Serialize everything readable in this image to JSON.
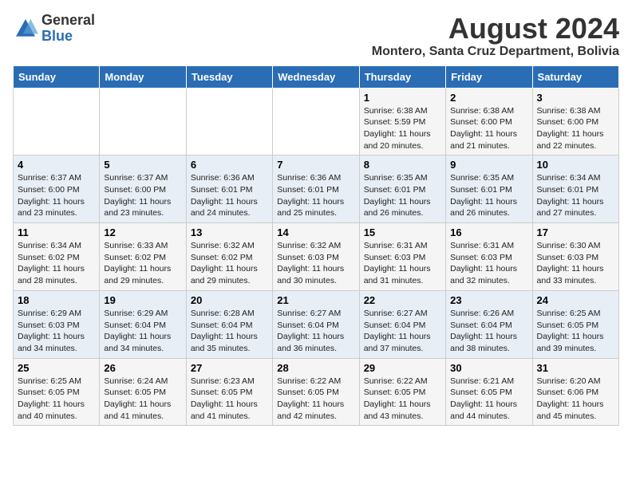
{
  "header": {
    "logo_general": "General",
    "logo_blue": "Blue",
    "month_year": "August 2024",
    "location": "Montero, Santa Cruz Department, Bolivia"
  },
  "weekdays": [
    "Sunday",
    "Monday",
    "Tuesday",
    "Wednesday",
    "Thursday",
    "Friday",
    "Saturday"
  ],
  "weeks": [
    [
      {
        "day": "",
        "info": ""
      },
      {
        "day": "",
        "info": ""
      },
      {
        "day": "",
        "info": ""
      },
      {
        "day": "",
        "info": ""
      },
      {
        "day": "1",
        "info": "Sunrise: 6:38 AM\nSunset: 5:59 PM\nDaylight: 11 hours\nand 20 minutes."
      },
      {
        "day": "2",
        "info": "Sunrise: 6:38 AM\nSunset: 6:00 PM\nDaylight: 11 hours\nand 21 minutes."
      },
      {
        "day": "3",
        "info": "Sunrise: 6:38 AM\nSunset: 6:00 PM\nDaylight: 11 hours\nand 22 minutes."
      }
    ],
    [
      {
        "day": "4",
        "info": "Sunrise: 6:37 AM\nSunset: 6:00 PM\nDaylight: 11 hours\nand 23 minutes."
      },
      {
        "day": "5",
        "info": "Sunrise: 6:37 AM\nSunset: 6:00 PM\nDaylight: 11 hours\nand 23 minutes."
      },
      {
        "day": "6",
        "info": "Sunrise: 6:36 AM\nSunset: 6:01 PM\nDaylight: 11 hours\nand 24 minutes."
      },
      {
        "day": "7",
        "info": "Sunrise: 6:36 AM\nSunset: 6:01 PM\nDaylight: 11 hours\nand 25 minutes."
      },
      {
        "day": "8",
        "info": "Sunrise: 6:35 AM\nSunset: 6:01 PM\nDaylight: 11 hours\nand 26 minutes."
      },
      {
        "day": "9",
        "info": "Sunrise: 6:35 AM\nSunset: 6:01 PM\nDaylight: 11 hours\nand 26 minutes."
      },
      {
        "day": "10",
        "info": "Sunrise: 6:34 AM\nSunset: 6:01 PM\nDaylight: 11 hours\nand 27 minutes."
      }
    ],
    [
      {
        "day": "11",
        "info": "Sunrise: 6:34 AM\nSunset: 6:02 PM\nDaylight: 11 hours\nand 28 minutes."
      },
      {
        "day": "12",
        "info": "Sunrise: 6:33 AM\nSunset: 6:02 PM\nDaylight: 11 hours\nand 29 minutes."
      },
      {
        "day": "13",
        "info": "Sunrise: 6:32 AM\nSunset: 6:02 PM\nDaylight: 11 hours\nand 29 minutes."
      },
      {
        "day": "14",
        "info": "Sunrise: 6:32 AM\nSunset: 6:03 PM\nDaylight: 11 hours\nand 30 minutes."
      },
      {
        "day": "15",
        "info": "Sunrise: 6:31 AM\nSunset: 6:03 PM\nDaylight: 11 hours\nand 31 minutes."
      },
      {
        "day": "16",
        "info": "Sunrise: 6:31 AM\nSunset: 6:03 PM\nDaylight: 11 hours\nand 32 minutes."
      },
      {
        "day": "17",
        "info": "Sunrise: 6:30 AM\nSunset: 6:03 PM\nDaylight: 11 hours\nand 33 minutes."
      }
    ],
    [
      {
        "day": "18",
        "info": "Sunrise: 6:29 AM\nSunset: 6:03 PM\nDaylight: 11 hours\nand 34 minutes."
      },
      {
        "day": "19",
        "info": "Sunrise: 6:29 AM\nSunset: 6:04 PM\nDaylight: 11 hours\nand 34 minutes."
      },
      {
        "day": "20",
        "info": "Sunrise: 6:28 AM\nSunset: 6:04 PM\nDaylight: 11 hours\nand 35 minutes."
      },
      {
        "day": "21",
        "info": "Sunrise: 6:27 AM\nSunset: 6:04 PM\nDaylight: 11 hours\nand 36 minutes."
      },
      {
        "day": "22",
        "info": "Sunrise: 6:27 AM\nSunset: 6:04 PM\nDaylight: 11 hours\nand 37 minutes."
      },
      {
        "day": "23",
        "info": "Sunrise: 6:26 AM\nSunset: 6:04 PM\nDaylight: 11 hours\nand 38 minutes."
      },
      {
        "day": "24",
        "info": "Sunrise: 6:25 AM\nSunset: 6:05 PM\nDaylight: 11 hours\nand 39 minutes."
      }
    ],
    [
      {
        "day": "25",
        "info": "Sunrise: 6:25 AM\nSunset: 6:05 PM\nDaylight: 11 hours\nand 40 minutes."
      },
      {
        "day": "26",
        "info": "Sunrise: 6:24 AM\nSunset: 6:05 PM\nDaylight: 11 hours\nand 41 minutes."
      },
      {
        "day": "27",
        "info": "Sunrise: 6:23 AM\nSunset: 6:05 PM\nDaylight: 11 hours\nand 41 minutes."
      },
      {
        "day": "28",
        "info": "Sunrise: 6:22 AM\nSunset: 6:05 PM\nDaylight: 11 hours\nand 42 minutes."
      },
      {
        "day": "29",
        "info": "Sunrise: 6:22 AM\nSunset: 6:05 PM\nDaylight: 11 hours\nand 43 minutes."
      },
      {
        "day": "30",
        "info": "Sunrise: 6:21 AM\nSunset: 6:05 PM\nDaylight: 11 hours\nand 44 minutes."
      },
      {
        "day": "31",
        "info": "Sunrise: 6:20 AM\nSunset: 6:06 PM\nDaylight: 11 hours\nand 45 minutes."
      }
    ]
  ]
}
